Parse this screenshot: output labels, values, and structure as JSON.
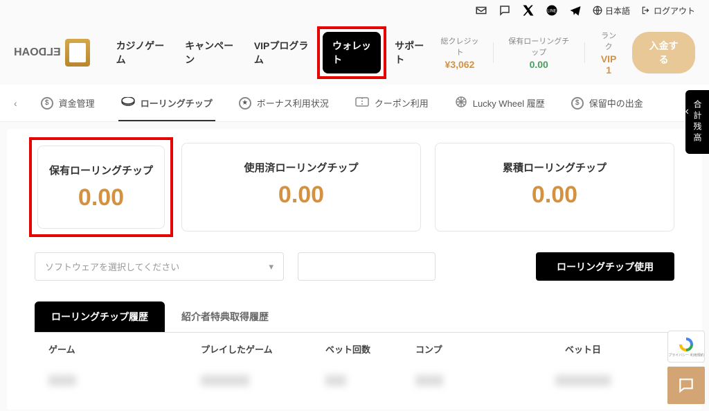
{
  "topbar": {
    "language": "日本語",
    "logout": "ログアウト"
  },
  "logo": "ELDOAH",
  "nav": {
    "casino": "カジノゲーム",
    "campaign": "キャンペーン",
    "vip": "VIPプログラム",
    "wallet": "ウォレット",
    "support": "サポート"
  },
  "stats": {
    "credit_label": "総クレジット",
    "credit_value": "¥3,062",
    "rolling_label": "保有ローリングチップ",
    "rolling_value": "0.00",
    "rank_label": "ランク",
    "rank_value": "VIP 1"
  },
  "deposit_btn": "入金する",
  "subnav": {
    "funds": "資金管理",
    "rolling": "ローリングチップ",
    "bonus": "ボーナス利用状況",
    "coupon": "クーポン利用",
    "lucky": "Lucky Wheel 履歴",
    "pending": "保留中の出金"
  },
  "cards": {
    "held_label": "保有ローリングチップ",
    "held_value": "0.00",
    "used_label": "使用済ローリングチップ",
    "used_value": "0.00",
    "total_label": "累積ローリングチップ",
    "total_value": "0.00"
  },
  "controls": {
    "select_placeholder": "ソフトウェアを選択してください",
    "use_btn": "ローリングチップ使用"
  },
  "tabs": {
    "history": "ローリングチップ履歴",
    "referral": "紹介者特典取得履歴"
  },
  "table": {
    "game": "ゲーム",
    "played": "プレイしたゲーム",
    "bet_count": "ベット回数",
    "comp": "コンプ",
    "bet_date": "ベット日"
  },
  "side_tab": "合計残高"
}
